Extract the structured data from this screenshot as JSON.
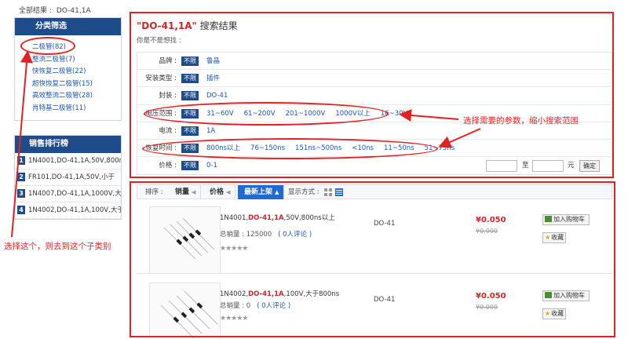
{
  "breadcrumb": {
    "label": "全部结果 :",
    "value": "DO-41,1A"
  },
  "sidebar": {
    "category_title": "分类筛选",
    "categories": [
      {
        "label": "二极管(82)"
      },
      {
        "label": "整流二极管(7)"
      },
      {
        "label": "快恢复二极管(22)"
      },
      {
        "label": "超快恢复二极管(15)"
      },
      {
        "label": "高效整流二极管(28)"
      },
      {
        "label": "肖特基二极管(11)"
      }
    ],
    "ranking_title": "销售排行榜",
    "ranking": [
      {
        "num": "1",
        "text": "1N4001,DO-41,1A,50V,800ns以"
      },
      {
        "num": "2",
        "text": "FR101,DO-41,1A,50V,小于"
      },
      {
        "num": "3",
        "text": "1N4007,DO-41,1A,1000V,大于"
      },
      {
        "num": "4",
        "text": "1N4002,DO-41,1A,100V,大于"
      }
    ]
  },
  "results": {
    "keyword": "\"DO-41,1A\"",
    "title_suffix": " 搜索结果",
    "suggest": "你是不是想找 :"
  },
  "filters": [
    {
      "label": "品牌 :",
      "nolimit": "不限",
      "options": [
        "鲁晶"
      ]
    },
    {
      "label": "安装类型 :",
      "nolimit": "不限",
      "options": [
        "插件"
      ]
    },
    {
      "label": "封装 :",
      "nolimit": "不限",
      "options": [
        "DO-41"
      ]
    },
    {
      "label": "电压范围 :",
      "nolimit": "不限",
      "options": [
        "31~60V",
        "61~200V",
        "201~1000V",
        "1000V以上",
        "16~30V"
      ]
    },
    {
      "label": "电流 :",
      "nolimit": "不限",
      "options": [
        "1A"
      ]
    },
    {
      "label": "恢复时间 :",
      "nolimit": "不限",
      "options": [
        "800ns以上",
        "76~150ns",
        "151ns~500ns",
        "<10ns",
        "11~50ns",
        "51~75ns"
      ]
    },
    {
      "label": "价格 :",
      "nolimit": "不限",
      "options": [
        "0-1"
      ]
    }
  ],
  "price_filter": {
    "to": "至",
    "unit": "元",
    "confirm": "确定"
  },
  "sortbar": {
    "label": "排序 :",
    "sales": "销量",
    "price": "价格",
    "newest": "最新上架",
    "view_label": "显示方式 :"
  },
  "products": [
    {
      "name_prefix": "1N4001,",
      "name_hl": "DO-41,1A",
      "name_suffix": ",50V,800ns以上",
      "sales_label": "总销量 : 125000",
      "comments": "( 0人评论 )",
      "package": "DO-41",
      "price": "¥0.050",
      "old_price": "¥0.000",
      "cart": "加入购物车",
      "fav": "收藏",
      "stars": "★★★★★"
    },
    {
      "name_prefix": "1N4002,",
      "name_hl": "DO-41,1A",
      "name_suffix": ",100V,大于800ns",
      "sales_label": "总销量 : 0",
      "comments": "( 0人评论 )",
      "package": "DO-41",
      "price": "¥0.050",
      "old_price": "¥0.000",
      "cart": "加入购物车",
      "fav": "收藏",
      "stars": "★★★★★"
    }
  ],
  "annotations": {
    "left_note": "选择这个，则去到这个子类别",
    "right_note": "选择需要的参数，缩小搜索范围"
  },
  "colors": {
    "accent_red": "#e62020",
    "nav_blue": "#1e4b8a",
    "link_blue": "#1a56b4",
    "price_red": "#c8282c"
  }
}
